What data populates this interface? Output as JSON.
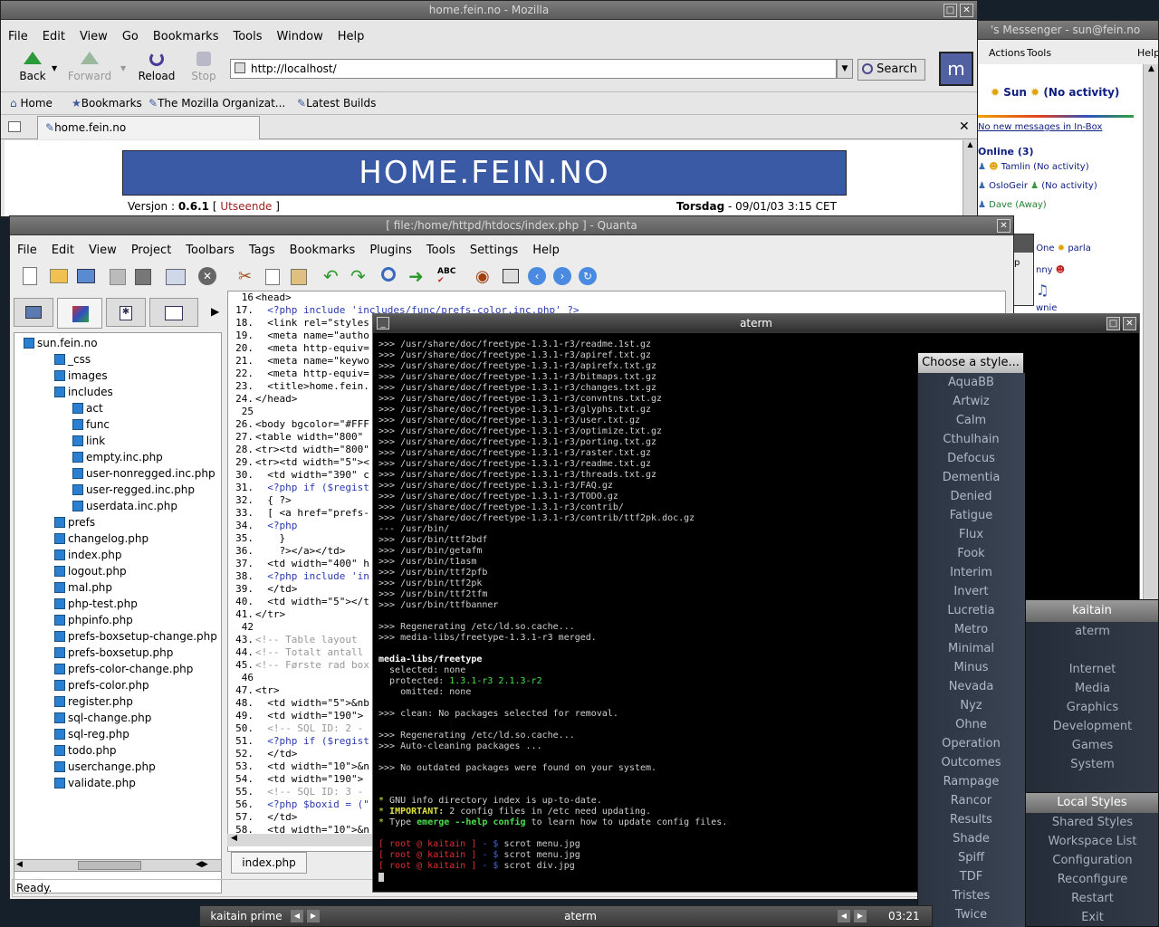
{
  "mozilla": {
    "title": "home.fein.no - Mozilla",
    "menu": [
      "File",
      "Edit",
      "View",
      "Go",
      "Bookmarks",
      "Tools",
      "Window",
      "Help"
    ],
    "back": "Back",
    "forward": "Forward",
    "reload": "Reload",
    "stop": "Stop",
    "url": "http://localhost/",
    "search": "Search",
    "personal": [
      "Home",
      "Bookmarks",
      "The Mozilla Organizat...",
      "Latest Builds"
    ],
    "tab": "home.fein.no",
    "banner": "HOME.FEIN.NO",
    "version_label": "Versjon :",
    "version": "0.6.1",
    "bracket_open": "[",
    "utseende": "Utseende",
    "bracket_close": "]",
    "day": "Torsdag",
    "date": "- 09/01/03 3:15 CET"
  },
  "messenger": {
    "title": "'s Messenger - sun@fein.no",
    "menu": [
      "Actions",
      "Tools"
    ],
    "help": "Help",
    "user": "Sun",
    "status": "(No activity)",
    "newmsg": "No new messages in In-Box",
    "online": "Online (3)",
    "buddies": [
      {
        "name": "Tamlin (No activity)"
      },
      {
        "name": "OsloGeir"
      },
      {
        "name": "(No activity)"
      },
      {
        "name": "Dave (Away)"
      }
    ],
    "nameless": "Nameless One",
    "parla": "parla",
    "nny": "nny",
    "wnie": "wnie",
    "ip": "Ip"
  },
  "quanta": {
    "title": "[  file:/home/httpd/htdocs/index.php  ]  - Quanta",
    "menu": [
      "File",
      "Edit",
      "View",
      "Project",
      "Toolbars",
      "Tags",
      "Bookmarks",
      "Plugins",
      "Tools",
      "Settings",
      "Help"
    ],
    "tree": [
      {
        "label": "sun.fein.no",
        "d": 0
      },
      {
        "label": "_css",
        "d": 1
      },
      {
        "label": "images",
        "d": 1
      },
      {
        "label": "includes",
        "d": 1
      },
      {
        "label": "act",
        "d": 2
      },
      {
        "label": "func",
        "d": 2
      },
      {
        "label": "link",
        "d": 2
      },
      {
        "label": "empty.inc.php",
        "d": 2
      },
      {
        "label": "user-nonregged.inc.php",
        "d": 2
      },
      {
        "label": "user-regged.inc.php",
        "d": 2
      },
      {
        "label": "userdata.inc.php",
        "d": 2
      },
      {
        "label": "prefs",
        "d": 1
      },
      {
        "label": "changelog.php",
        "d": 1
      },
      {
        "label": "index.php",
        "d": 1
      },
      {
        "label": "logout.php",
        "d": 1
      },
      {
        "label": "mal.php",
        "d": 1
      },
      {
        "label": "php-test.php",
        "d": 1
      },
      {
        "label": "phpinfo.php",
        "d": 1
      },
      {
        "label": "prefs-boxsetup-change.php",
        "d": 1
      },
      {
        "label": "prefs-boxsetup.php",
        "d": 1
      },
      {
        "label": "prefs-color-change.php",
        "d": 1
      },
      {
        "label": "prefs-color.php",
        "d": 1
      },
      {
        "label": "register.php",
        "d": 1
      },
      {
        "label": "sql-change.php",
        "d": 1
      },
      {
        "label": "sql-reg.php",
        "d": 1
      },
      {
        "label": "todo.php",
        "d": 1
      },
      {
        "label": "userchange.php",
        "d": 1
      },
      {
        "label": "validate.php",
        "d": 1
      }
    ],
    "code": [
      {
        "n": "16",
        "t": "<head>"
      },
      {
        "n": "17.",
        "t": "  <?php include 'includes/func/prefs-color.inc.php' ?>"
      },
      {
        "n": "18.",
        "t": "  <link rel=\"styles"
      },
      {
        "n": "19.",
        "t": "  <meta name=\"autho"
      },
      {
        "n": "20.",
        "t": "  <meta http-equiv="
      },
      {
        "n": "21.",
        "t": "  <meta name=\"keywo"
      },
      {
        "n": "22.",
        "t": "  <meta http-equiv="
      },
      {
        "n": "23.",
        "t": "  <title>home.fein."
      },
      {
        "n": "24.",
        "t": "</head>"
      },
      {
        "n": "25",
        "t": ""
      },
      {
        "n": "26.",
        "t": "<body bgcolor=\"#FFF"
      },
      {
        "n": "27.",
        "t": "<table width=\"800\""
      },
      {
        "n": "28.",
        "t": "<tr><td width=\"800\""
      },
      {
        "n": "29.",
        "t": "<tr><td width=\"5\"><"
      },
      {
        "n": "30.",
        "t": "  <td width=\"390\" c"
      },
      {
        "n": "31.",
        "t": "  <?php if ($regist"
      },
      {
        "n": "32.",
        "t": "  { ?>"
      },
      {
        "n": "33.",
        "t": "  [ <a href=\"prefs-"
      },
      {
        "n": "34.",
        "t": "  <?php"
      },
      {
        "n": "35.",
        "t": "    }"
      },
      {
        "n": "36.",
        "t": "    ?></a></td>"
      },
      {
        "n": "37.",
        "t": "  <td width=\"400\" h"
      },
      {
        "n": "38.",
        "t": "  <?php include 'in"
      },
      {
        "n": "39.",
        "t": "  </td>"
      },
      {
        "n": "40.",
        "t": "  <td width=\"5\"></t"
      },
      {
        "n": "41.",
        "t": "</tr>"
      },
      {
        "n": "42",
        "t": ""
      },
      {
        "n": "43.",
        "t": "<!-- Table layout "
      },
      {
        "n": "44.",
        "t": "<!-- Totalt antall"
      },
      {
        "n": "45.",
        "t": "<!-- Første rad box"
      },
      {
        "n": "46",
        "t": ""
      },
      {
        "n": "47.",
        "t": "<tr>"
      },
      {
        "n": "48.",
        "t": "  <td width=\"5\">&nb"
      },
      {
        "n": "49.",
        "t": "  <td width=\"190\">"
      },
      {
        "n": "50.",
        "t": "  <!-- SQL ID: 2 - "
      },
      {
        "n": "51.",
        "t": "  <?php if ($regist"
      },
      {
        "n": "52.",
        "t": "  </td>"
      },
      {
        "n": "53.",
        "t": "  <td width=\"10\">&n"
      },
      {
        "n": "54.",
        "t": "  <td width=\"190\">"
      },
      {
        "n": "55.",
        "t": "  <!-- SQL ID: 3 - "
      },
      {
        "n": "56.",
        "t": "  <?php $boxid = (\""
      },
      {
        "n": "57.",
        "t": "  </td>"
      },
      {
        "n": "58.",
        "t": "  <td width=\"10\">&n"
      }
    ],
    "filetab": "index.php",
    "status": "Ready."
  },
  "aterm": {
    "title": "aterm",
    "lines": [
      ">>> /usr/share/doc/freetype-1.3.1-r3/readme.1st.gz",
      ">>> /usr/share/doc/freetype-1.3.1-r3/apiref.txt.gz",
      ">>> /usr/share/doc/freetype-1.3.1-r3/apirefx.txt.gz",
      ">>> /usr/share/doc/freetype-1.3.1-r3/bitmaps.txt.gz",
      ">>> /usr/share/doc/freetype-1.3.1-r3/changes.txt.gz",
      ">>> /usr/share/doc/freetype-1.3.1-r3/convntns.txt.gz",
      ">>> /usr/share/doc/freetype-1.3.1-r3/glyphs.txt.gz",
      ">>> /usr/share/doc/freetype-1.3.1-r3/user.txt.gz",
      ">>> /usr/share/doc/freetype-1.3.1-r3/optimize.txt.gz",
      ">>> /usr/share/doc/freetype-1.3.1-r3/porting.txt.gz",
      ">>> /usr/share/doc/freetype-1.3.1-r3/raster.txt.gz",
      ">>> /usr/share/doc/freetype-1.3.1-r3/readme.txt.gz",
      ">>> /usr/share/doc/freetype-1.3.1-r3/threads.txt.gz",
      ">>> /usr/share/doc/freetype-1.3.1-r3/FAQ.gz",
      ">>> /usr/share/doc/freetype-1.3.1-r3/TODO.gz",
      ">>> /usr/share/doc/freetype-1.3.1-r3/contrib/",
      ">>> /usr/share/doc/freetype-1.3.1-r3/contrib/ttf2pk.doc.gz",
      "--- /usr/bin/",
      ">>> /usr/bin/ttf2bdf",
      ">>> /usr/bin/getafm",
      ">>> /usr/bin/t1asm",
      ">>> /usr/bin/ttf2pfb",
      ">>> /usr/bin/ttf2pk",
      ">>> /usr/bin/ttf2tfm",
      ">>> /usr/bin/ttfbanner",
      "",
      ">>> Regenerating /etc/ld.so.cache...",
      ">>> media-libs/freetype-1.3.1-r3 merged.",
      ""
    ],
    "pkg": "media-libs/freetype",
    "selected": "  selected: none",
    "protected_label": "  protected:",
    "protected_val": "1.3.1-r3 2.1.3-r2",
    "omitted": "    omitted: none",
    "clean": ">>> clean: No packages selected for removal.",
    "regen": ">>> Regenerating /etc/ld.so.cache...",
    "autoclean": ">>> Auto-cleaning packages ...",
    "noout": ">>> No outdated packages were found on your system.",
    "info1": "GNU info directory index is up-to-date.",
    "important": "IMPORTANT:",
    "info2": " 2 config files in /etc need updating.",
    "info3a": "Type ",
    "info3b": "emerge --help config",
    "info3c": " to learn how to update config files.",
    "prompt_user": "[ root @ kaitain ]",
    "prompt_sep": " - $ ",
    "cmds": [
      "scrot menu.jpg",
      "scrot menu.jpg",
      "scrot div.jpg"
    ]
  },
  "stylemenu": {
    "title": "Choose a style...",
    "items": [
      "AquaBB",
      "Artwiz",
      "Calm",
      "Cthulhain",
      "Defocus",
      "Dementia",
      "Denied",
      "Fatigue",
      "Flux",
      "Fook",
      "Interim",
      "Invert",
      "Lucretia",
      "Metro",
      "Minimal",
      "Minus",
      "Nevada",
      "Nyz",
      "Ohne",
      "Operation",
      "Outcomes",
      "Rampage",
      "Rancor",
      "Results",
      "Shade",
      "Spiff",
      "TDF",
      "Tristes",
      "Twice"
    ]
  },
  "rootmenu": {
    "title": "kaitain",
    "items": [
      "aterm",
      "",
      "Internet",
      "Media",
      "Graphics",
      "Development",
      "Games",
      "System"
    ],
    "sub_title": "Local Styles",
    "sub_items": [
      "Shared Styles",
      "Workspace List",
      "Configuration",
      "Reconfigure",
      "Restart",
      "Exit"
    ]
  },
  "toolbar": {
    "workspace": "kaitain prime",
    "window": "aterm",
    "clock": "03:21"
  }
}
